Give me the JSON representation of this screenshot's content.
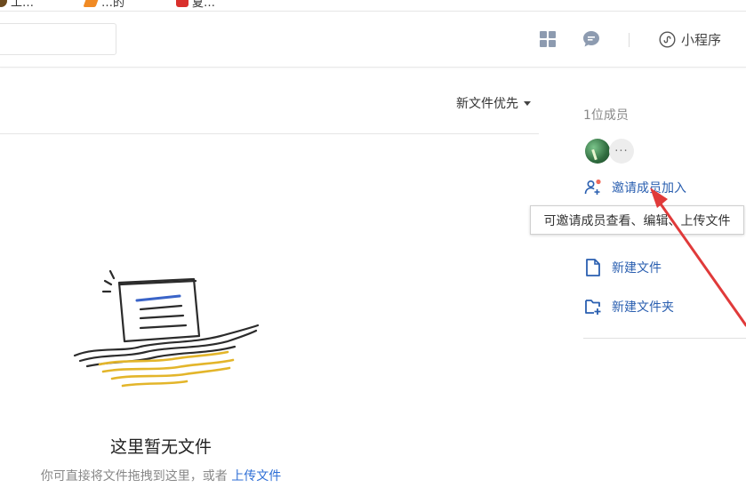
{
  "bookmarks": [
    {
      "label": "工…",
      "icon": "avatar-icon"
    },
    {
      "label": "…的"
    },
    {
      "label": "夏…",
      "icon": "app-icon"
    }
  ],
  "header": {
    "mini_program_label": "小程序",
    "icons": [
      "grid-icon",
      "chat-icon",
      "mini-program-icon"
    ]
  },
  "list": {
    "sort_label": "新文件优先"
  },
  "empty_state": {
    "title": "这里暂无文件",
    "subtitle": "你可直接将文件拖拽到这里，或者 ",
    "upload_link": "上传文件"
  },
  "sidebar": {
    "member_count": "1位成员",
    "invite_label": "邀请成员加入",
    "new_file_label": "新建文件",
    "new_folder_label": "新建文件夹",
    "more_label": "···"
  },
  "tooltip": {
    "text": "可邀请成员查看、编辑、上传文件"
  },
  "colors": {
    "link": "#2a5fb0",
    "annotation": "#e03a3a",
    "icon_gray": "#8d9bb0"
  }
}
